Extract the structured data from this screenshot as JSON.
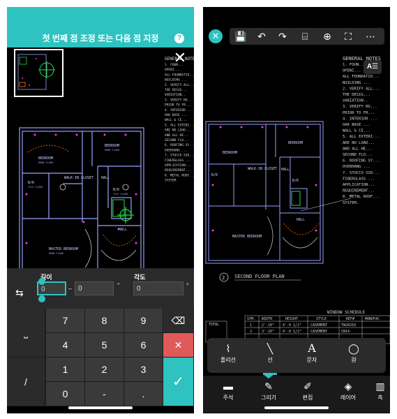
{
  "left": {
    "header_title": "첫 번째 점 조정 또는 다음 점 지정",
    "help_icon": "?",
    "close_icon": "✕",
    "input": {
      "length_label": "길이",
      "length_value": "0",
      "length_extra": "0",
      "length_unit_marker": "''",
      "angle_label": "각도",
      "angle_value": "0",
      "angle_unit": "°"
    },
    "keypad": {
      "keys": [
        "7",
        "8",
        "9",
        "4",
        "5",
        "6",
        "1",
        "2",
        "3",
        "0",
        "-",
        "."
      ],
      "space_key": "⎵",
      "slash_key": "/",
      "backspace_icon": "⌫",
      "cancel_icon": "✕",
      "confirm_icon": "✓"
    }
  },
  "drawing": {
    "rooms": [
      "BEDROOM",
      "BEDROOM",
      "WALK-IN CLOSET",
      "HALL",
      "B/R",
      "B/R",
      "MASTER BEDROOM",
      "HALL"
    ],
    "floor_note": "HRWD FLOOR",
    "tile_note": "TILE FLOOR",
    "notes_title": "GENERAL NOTES",
    "plan_title": "SECOND FLOOR PLAN",
    "plan_number": "2",
    "window_schedule_title": "WINDOW SCHEDULE",
    "schedule_headers": [
      "SYM.",
      "WIDTH",
      "HEIGHT",
      "STYLE",
      "REF#",
      "MANUFAC"
    ],
    "schedule_rows": [
      [
        "1",
        "2'-10\"",
        "4'-0 1/2\"",
        "CASEMENT",
        "TW28310",
        ""
      ],
      [
        "2",
        "3'-10\"",
        "4'-0 1/2\"",
        "CASEMENT",
        "CN14",
        ""
      ]
    ],
    "total_label": "TOTAL",
    "notes_lines": [
      "1. FOUN...",
      "OPENI...",
      "ALL FOUNDATIO...",
      "BUILDING ...",
      "2. VERIFY ALL...",
      "THE DESIG...",
      "VARIATION..",
      "3. VERIFY RO...",
      "PRIOR TO FR...",
      "4. INTERIOR ...",
      "OAK BASE ...",
      "WALL & CE...",
      "5. ALL EXTERI...",
      "ARE NO LOAD...",
      "AND ALL HE...",
      "SECOND FLO...",
      "6. ROOFING SY...",
      "OVERHANG ...",
      "7. STUCCO SID...",
      "FIBERGLASS ...",
      "APPLICATION...",
      "REQUIREMENT...",
      "8. METAL ROOF...",
      "SYSTEM."
    ]
  },
  "right": {
    "close_icon": "✕",
    "toolbar_icons": [
      "save-icon",
      "undo-icon",
      "redo-icon",
      "select-icon",
      "zoom-icon",
      "fullscreen-icon",
      "more-icon"
    ],
    "ae_button": "A☰",
    "draw_tools": [
      {
        "name": "polyline",
        "label": "폴리선"
      },
      {
        "name": "line",
        "label": "선"
      },
      {
        "name": "text",
        "label": "문자"
      },
      {
        "name": "circle",
        "label": "원"
      }
    ],
    "bottom_nav": [
      {
        "name": "annotation",
        "label": "주석"
      },
      {
        "name": "draw",
        "label": "그리기"
      },
      {
        "name": "edit",
        "label": "편집"
      },
      {
        "name": "layer",
        "label": "레이어"
      },
      {
        "name": "measure",
        "label": "측"
      }
    ]
  },
  "colors": {
    "accent": "#2ec3c1",
    "red_key": "#e05a5a",
    "wall": "#9aa0ff",
    "text_green": "#8fd68f",
    "highlight": "#22dd44"
  }
}
